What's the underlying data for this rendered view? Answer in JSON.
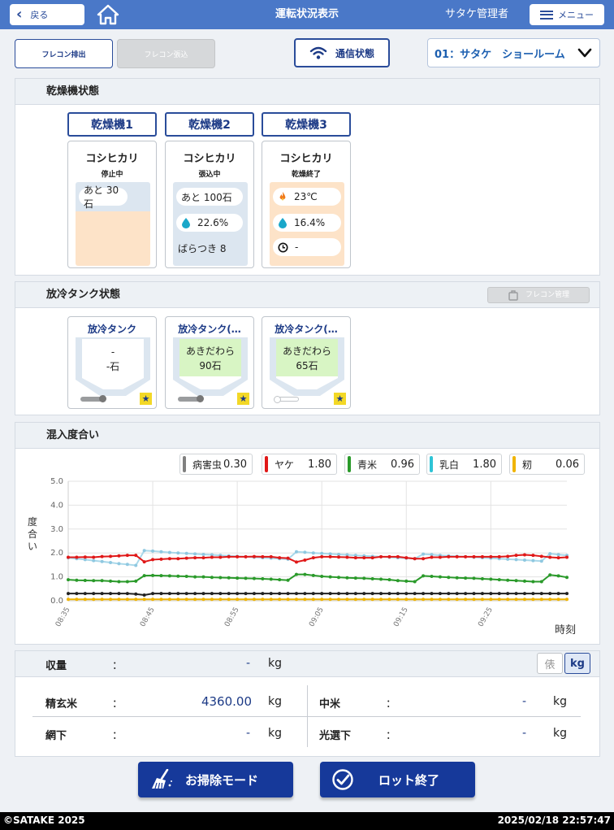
{
  "header": {
    "back_label": "戻る",
    "title": "運転状況表示",
    "user": "サタケ管理者",
    "menu_label": "メニュー"
  },
  "toolbar": {
    "flecon_out_label": "フレコン排出",
    "flecon_in_label": "フレコン張込",
    "comm_label": "通信状態",
    "site_select": "01：サタケ　ショールーム"
  },
  "dryer_panel": {
    "title": "乾燥機状態",
    "dryers": [
      {
        "tab": "乾燥機1",
        "variety": "コシヒカリ",
        "status": "停止中",
        "remaining": "あと 30石"
      },
      {
        "tab": "乾燥機2",
        "variety": "コシヒカリ",
        "status": "張込中",
        "remaining": "あと 100石",
        "moisture": "22.6%",
        "variation": "ばらつき 8"
      },
      {
        "tab": "乾燥機3",
        "variety": "コシヒカリ",
        "status": "乾燥終了",
        "temperature": "23℃",
        "moisture": "16.4%",
        "time": "-"
      }
    ]
  },
  "tank_panel": {
    "title": "放冷タンク状態",
    "flecon_mgmt_label": "フレコン管理",
    "tanks": [
      {
        "title": "放冷タンク",
        "variety": "-",
        "amount": "-石"
      },
      {
        "title": "放冷タンク(…",
        "variety": "あきだわら",
        "amount": "90石"
      },
      {
        "title": "放冷タンク(…",
        "variety": "あきだわら",
        "amount": "65石"
      }
    ]
  },
  "mix_panel": {
    "title": "混入度合い",
    "legend": [
      {
        "label": "病害虫",
        "value": "0.30",
        "color": "#808080"
      },
      {
        "label": "ヤケ",
        "value": "1.80",
        "color": "#e01818"
      },
      {
        "label": "青米",
        "value": "0.96",
        "color": "#2a9a2a"
      },
      {
        "label": "乳白",
        "value": "1.80",
        "color": "#2ec4d6"
      },
      {
        "label": "籾",
        "value": "0.06",
        "color": "#f0b400"
      }
    ]
  },
  "chart_data": {
    "type": "line",
    "ylabel": "度合い",
    "xlabel": "時刻",
    "ylim": [
      0,
      5.0
    ],
    "yticks": [
      "0.0",
      "1.0",
      "2.0",
      "3.0",
      "4.0",
      "5.0"
    ],
    "xlim": [
      "08:35",
      "09:34"
    ],
    "xticks": [
      "08:35",
      "08:45",
      "08:55",
      "09:05",
      "09:15",
      "09:25"
    ],
    "grid": true,
    "series": [
      {
        "name": "乳白",
        "color": "#a9d8ea",
        "marker_color": "#8fc8e0",
        "values": [
          1.8,
          1.76,
          1.72,
          1.68,
          1.64,
          1.6,
          1.55,
          1.52,
          1.48,
          2.1,
          2.08,
          2.05,
          2.02,
          2.0,
          1.98,
          1.96,
          1.94,
          1.92,
          1.9,
          1.88,
          1.86,
          1.84,
          1.82,
          1.8,
          1.78,
          1.76,
          1.74,
          2.05,
          2.03,
          2.0,
          1.98,
          1.96,
          1.94,
          1.92,
          1.9,
          1.88,
          1.86,
          1.84,
          1.82,
          1.8,
          1.78,
          1.76,
          1.95,
          1.93,
          1.9,
          1.88,
          1.86,
          1.84,
          1.82,
          1.8,
          1.78,
          1.76,
          1.74,
          1.72,
          1.7,
          1.68,
          1.66,
          1.97,
          1.93,
          1.9
        ]
      },
      {
        "name": "ヤケ",
        "color": "#e01818",
        "marker_color": "#e01818",
        "values": [
          1.82,
          1.82,
          1.83,
          1.82,
          1.85,
          1.86,
          1.88,
          1.9,
          1.9,
          1.63,
          1.72,
          1.74,
          1.76,
          1.76,
          1.78,
          1.8,
          1.8,
          1.82,
          1.82,
          1.84,
          1.84,
          1.84,
          1.85,
          1.84,
          1.84,
          1.8,
          1.78,
          1.62,
          1.7,
          1.8,
          1.84,
          1.84,
          1.83,
          1.82,
          1.8,
          1.8,
          1.8,
          1.84,
          1.84,
          1.84,
          1.8,
          1.76,
          1.76,
          1.82,
          1.82,
          1.84,
          1.84,
          1.84,
          1.84,
          1.84,
          1.84,
          1.84,
          1.86,
          1.9,
          1.92,
          1.9,
          1.86,
          1.82,
          1.8,
          1.82
        ]
      },
      {
        "name": "青米",
        "color": "#2a9a2a",
        "marker_color": "#2a9a2a",
        "values": [
          0.88,
          0.86,
          0.85,
          0.84,
          0.84,
          0.82,
          0.8,
          0.8,
          0.82,
          1.05,
          1.06,
          1.05,
          1.04,
          1.03,
          1.02,
          1.0,
          1.0,
          0.98,
          0.97,
          0.96,
          0.95,
          0.94,
          0.93,
          0.92,
          0.9,
          0.88,
          0.86,
          1.1,
          1.1,
          1.06,
          1.02,
          1.0,
          0.98,
          0.96,
          0.95,
          0.94,
          0.92,
          0.9,
          0.88,
          0.84,
          0.82,
          0.8,
          1.04,
          1.02,
          1.0,
          0.98,
          0.96,
          0.95,
          0.94,
          0.92,
          0.9,
          0.88,
          0.86,
          0.84,
          0.82,
          0.8,
          0.8,
          1.08,
          1.04,
          0.98
        ]
      },
      {
        "name": "病害虫",
        "color": "#222222",
        "marker_color": "#222222",
        "values": [
          0.3,
          0.3,
          0.3,
          0.3,
          0.3,
          0.3,
          0.3,
          0.3,
          0.28,
          0.24,
          0.3,
          0.3,
          0.3,
          0.3,
          0.3,
          0.3,
          0.3,
          0.3,
          0.3,
          0.3,
          0.3,
          0.3,
          0.3,
          0.3,
          0.3,
          0.3,
          0.3,
          0.3,
          0.3,
          0.3,
          0.3,
          0.3,
          0.3,
          0.3,
          0.3,
          0.3,
          0.3,
          0.3,
          0.3,
          0.3,
          0.3,
          0.3,
          0.3,
          0.3,
          0.3,
          0.3,
          0.3,
          0.3,
          0.3,
          0.3,
          0.3,
          0.3,
          0.3,
          0.3,
          0.3,
          0.3,
          0.3,
          0.3,
          0.3,
          0.3
        ]
      },
      {
        "name": "籾",
        "color": "#f0b400",
        "marker_color": "#f0b400",
        "values": [
          0.06,
          0.06,
          0.06,
          0.06,
          0.06,
          0.06,
          0.06,
          0.06,
          0.06,
          0.06,
          0.06,
          0.06,
          0.06,
          0.06,
          0.06,
          0.06,
          0.06,
          0.06,
          0.06,
          0.06,
          0.06,
          0.06,
          0.06,
          0.06,
          0.06,
          0.06,
          0.06,
          0.06,
          0.06,
          0.06,
          0.06,
          0.06,
          0.06,
          0.06,
          0.06,
          0.06,
          0.06,
          0.06,
          0.06,
          0.06,
          0.06,
          0.06,
          0.06,
          0.06,
          0.06,
          0.06,
          0.06,
          0.06,
          0.06,
          0.06,
          0.06,
          0.06,
          0.06,
          0.06,
          0.06,
          0.06,
          0.06,
          0.06,
          0.06,
          0.06
        ]
      }
    ]
  },
  "yield_panel": {
    "title": "収量",
    "colon": "：",
    "total_value": "-",
    "unit": "kg",
    "unit_bale": "俵",
    "unit_kg": "kg",
    "rows": [
      {
        "label": "精玄米",
        "value": "4360.00"
      },
      {
        "label": "網下",
        "value": "-"
      },
      {
        "label": "中米",
        "value": "-"
      },
      {
        "label": "光選下",
        "value": "-"
      }
    ]
  },
  "actions": {
    "cleaning_label": "お掃除モード",
    "lot_end_label": "ロット終了"
  },
  "footer": {
    "copyright": "©SATAKE 2025",
    "datetime": "2025/02/18 22:57:47"
  },
  "colors": {
    "header_bg": "#4a78c8",
    "accent": "#1c3a86",
    "primary_button": "#16399a",
    "dryer1_fill": "#fde3c8",
    "dryer2_fill": "#dce6f0",
    "dryer3_fill": "#fde3c8",
    "tank_green": "#d8f5c4"
  }
}
